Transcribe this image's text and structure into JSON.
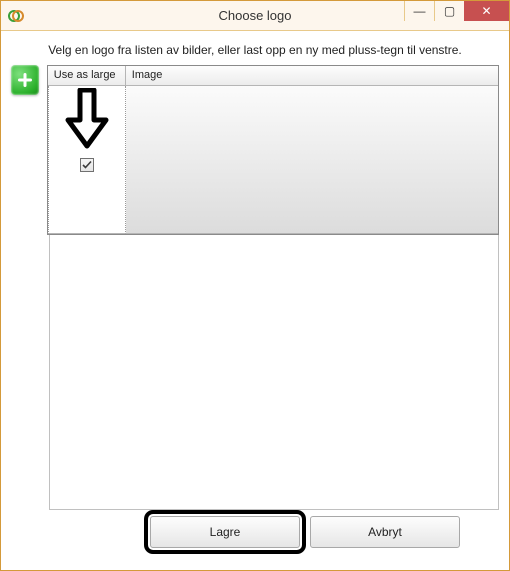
{
  "window": {
    "title": "Choose logo",
    "minimize_glyph": "—",
    "maximize_glyph": "▢",
    "close_glyph": "✕"
  },
  "instruction": "Velg en logo fra listen av bilder, eller last opp en ny med pluss-tegn til venstre.",
  "add_button_icon": "plus-icon",
  "grid": {
    "columns": {
      "use_as_large": "Use as large",
      "image": "Image"
    },
    "rows": [
      {
        "use_as_large_checked": true,
        "image": null
      }
    ]
  },
  "buttons": {
    "save": "Lagre",
    "cancel": "Avbryt"
  },
  "annotation": {
    "target": "use-as-large-checkbox",
    "highlight": "save-button"
  }
}
